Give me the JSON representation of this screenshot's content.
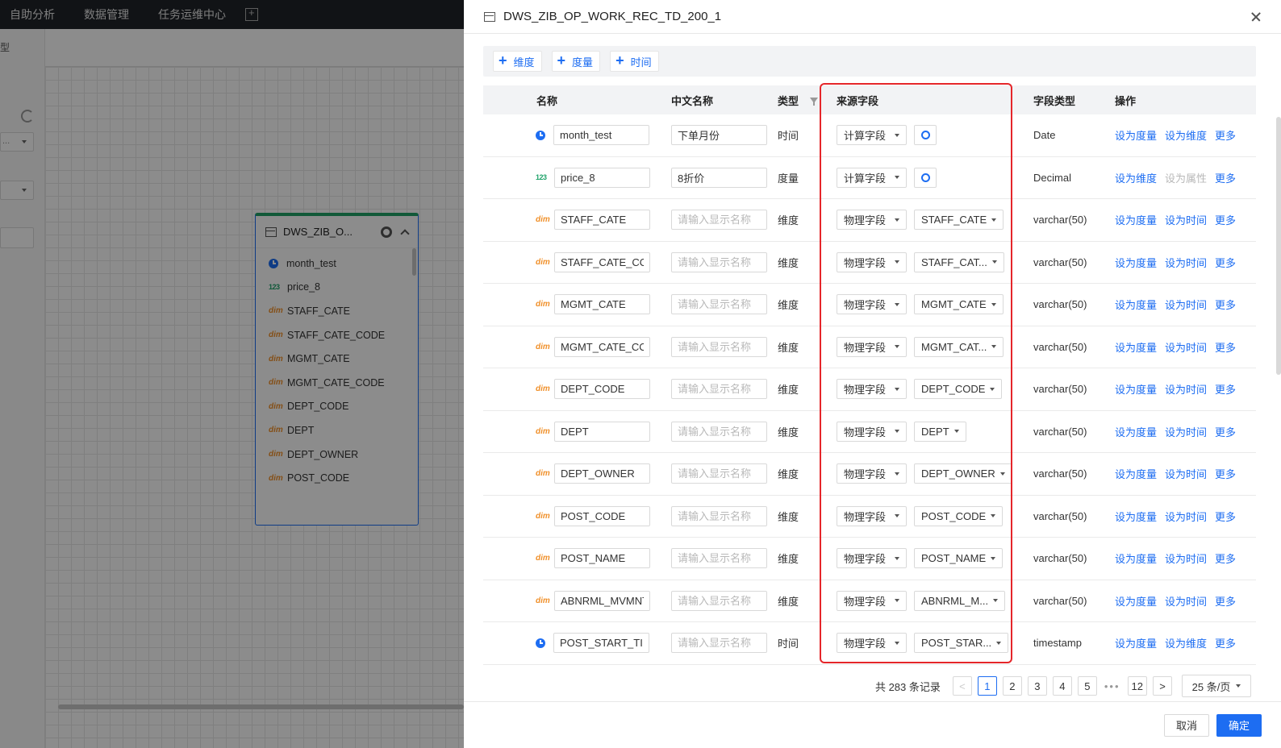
{
  "background": {
    "nav": [
      "自助分析",
      "数据管理",
      "任务运维中心"
    ],
    "left_label": "型",
    "select_placeholder": "...",
    "table_card": {
      "title": "DWS_ZIB_O...",
      "fields": [
        {
          "type": "time",
          "name": "month_test"
        },
        {
          "type": "num",
          "name": "price_8"
        },
        {
          "type": "dim",
          "name": "STAFF_CATE"
        },
        {
          "type": "dim",
          "name": "STAFF_CATE_CODE"
        },
        {
          "type": "dim",
          "name": "MGMT_CATE"
        },
        {
          "type": "dim",
          "name": "MGMT_CATE_CODE"
        },
        {
          "type": "dim",
          "name": "DEPT_CODE"
        },
        {
          "type": "dim",
          "name": "DEPT"
        },
        {
          "type": "dim",
          "name": "DEPT_OWNER"
        },
        {
          "type": "dim",
          "name": "POST_CODE"
        }
      ]
    }
  },
  "icons": {
    "num": "123",
    "dim": "dim"
  },
  "drawer": {
    "title": "DWS_ZIB_OP_WORK_REC_TD_200_1",
    "add_buttons": [
      "维度",
      "度量",
      "时间"
    ],
    "columns": {
      "name": "名称",
      "cn_name": "中文名称",
      "type": "类型",
      "source": "来源字段",
      "field_type": "字段类型",
      "ops": "操作"
    },
    "cn_placeholder": "请输入显示名称",
    "rows": [
      {
        "icon": "time",
        "name": "month_test",
        "cn": "下单月份",
        "type": "时间",
        "src": "计算字段",
        "src_field": null,
        "ft": "Date",
        "ops": [
          [
            "设为度量",
            false
          ],
          [
            "设为维度",
            false
          ],
          [
            "更多",
            false
          ]
        ]
      },
      {
        "icon": "num",
        "name": "price_8",
        "cn": "8折价",
        "type": "度量",
        "src": "计算字段",
        "src_field": null,
        "ft": "Decimal",
        "ops": [
          [
            "设为维度",
            false
          ],
          [
            "设为属性",
            true
          ],
          [
            "更多",
            false
          ]
        ]
      },
      {
        "icon": "dim",
        "name": "STAFF_CATE",
        "cn": "",
        "type": "维度",
        "src": "物理字段",
        "src_field": "STAFF_CATE",
        "ft": "varchar(50)",
        "ops": [
          [
            "设为度量",
            false
          ],
          [
            "设为时间",
            false
          ],
          [
            "更多",
            false
          ]
        ]
      },
      {
        "icon": "dim",
        "name": "STAFF_CATE_COD",
        "cn": "",
        "type": "维度",
        "src": "物理字段",
        "src_field": "STAFF_CAT...",
        "ft": "varchar(50)",
        "ops": [
          [
            "设为度量",
            false
          ],
          [
            "设为时间",
            false
          ],
          [
            "更多",
            false
          ]
        ]
      },
      {
        "icon": "dim",
        "name": "MGMT_CATE",
        "cn": "",
        "type": "维度",
        "src": "物理字段",
        "src_field": "MGMT_CATE",
        "ft": "varchar(50)",
        "ops": [
          [
            "设为度量",
            false
          ],
          [
            "设为时间",
            false
          ],
          [
            "更多",
            false
          ]
        ]
      },
      {
        "icon": "dim",
        "name": "MGMT_CATE_COD",
        "cn": "",
        "type": "维度",
        "src": "物理字段",
        "src_field": "MGMT_CAT...",
        "ft": "varchar(50)",
        "ops": [
          [
            "设为度量",
            false
          ],
          [
            "设为时间",
            false
          ],
          [
            "更多",
            false
          ]
        ]
      },
      {
        "icon": "dim",
        "name": "DEPT_CODE",
        "cn": "",
        "type": "维度",
        "src": "物理字段",
        "src_field": "DEPT_CODE",
        "ft": "varchar(50)",
        "ops": [
          [
            "设为度量",
            false
          ],
          [
            "设为时间",
            false
          ],
          [
            "更多",
            false
          ]
        ]
      },
      {
        "icon": "dim",
        "name": "DEPT",
        "cn": "",
        "type": "维度",
        "src": "物理字段",
        "src_field": "DEPT",
        "ft": "varchar(50)",
        "ops": [
          [
            "设为度量",
            false
          ],
          [
            "设为时间",
            false
          ],
          [
            "更多",
            false
          ]
        ]
      },
      {
        "icon": "dim",
        "name": "DEPT_OWNER",
        "cn": "",
        "type": "维度",
        "src": "物理字段",
        "src_field": "DEPT_OWNER",
        "ft": "varchar(50)",
        "ops": [
          [
            "设为度量",
            false
          ],
          [
            "设为时间",
            false
          ],
          [
            "更多",
            false
          ]
        ]
      },
      {
        "icon": "dim",
        "name": "POST_CODE",
        "cn": "",
        "type": "维度",
        "src": "物理字段",
        "src_field": "POST_CODE",
        "ft": "varchar(50)",
        "ops": [
          [
            "设为度量",
            false
          ],
          [
            "设为时间",
            false
          ],
          [
            "更多",
            false
          ]
        ]
      },
      {
        "icon": "dim",
        "name": "POST_NAME",
        "cn": "",
        "type": "维度",
        "src": "物理字段",
        "src_field": "POST_NAME",
        "ft": "varchar(50)",
        "ops": [
          [
            "设为度量",
            false
          ],
          [
            "设为时间",
            false
          ],
          [
            "更多",
            false
          ]
        ]
      },
      {
        "icon": "dim",
        "name": "ABNRML_MVMNT_",
        "cn": "",
        "type": "维度",
        "src": "物理字段",
        "src_field": "ABNRML_M...",
        "ft": "varchar(50)",
        "ops": [
          [
            "设为度量",
            false
          ],
          [
            "设为时间",
            false
          ],
          [
            "更多",
            false
          ]
        ]
      },
      {
        "icon": "time",
        "name": "POST_START_TIM",
        "cn": "",
        "type": "时间",
        "src": "物理字段",
        "src_field": "POST_STAR...",
        "ft": "timestamp",
        "ops": [
          [
            "设为度量",
            false
          ],
          [
            "设为维度",
            false
          ],
          [
            "更多",
            false
          ]
        ]
      }
    ],
    "pagination": {
      "total_text": "共 283 条记录",
      "pages": [
        "1",
        "2",
        "3",
        "4",
        "5"
      ],
      "current": "1",
      "ellipsis": "•••",
      "last_page": "12",
      "page_size": "25 条/页"
    },
    "footer": {
      "cancel": "取消",
      "confirm": "确定"
    }
  },
  "colors": {
    "accent": "#1d6df2",
    "highlight": "#e5262a",
    "dim": "#f0902a",
    "num": "#20a36a"
  }
}
